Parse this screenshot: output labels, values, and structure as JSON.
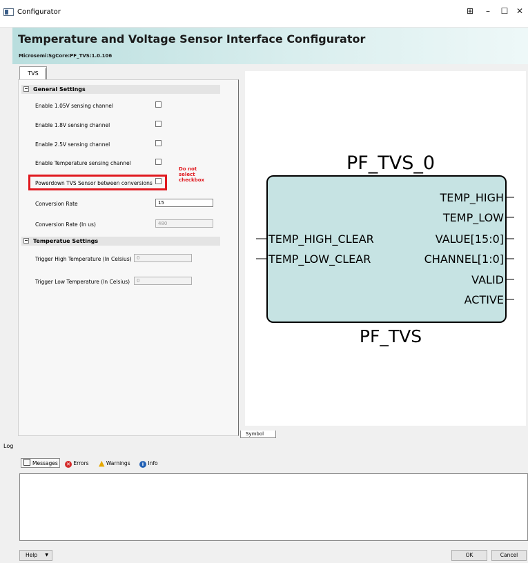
{
  "window": {
    "title": "Configurator",
    "controls": [
      "⊞",
      "–",
      "☐",
      "✕"
    ]
  },
  "header": {
    "title": "Temperature and Voltage Sensor Interface Configurator",
    "subtitle": "Microsemi:SgCore:PF_TVS:1.0.106"
  },
  "tabs": [
    "TVS"
  ],
  "general_settings": {
    "label": "General Settings",
    "options": [
      {
        "label": "Enable 1.05V sensing channel",
        "checked": false
      },
      {
        "label": "Enable 1.8V sensing channel",
        "checked": false
      },
      {
        "label": "Enable 2.5V sensing channel",
        "checked": false
      },
      {
        "label": "Enable Temperature  sensing channel",
        "checked": false
      },
      {
        "label": "Powerdown TVS Sensor between conversions",
        "checked": false
      }
    ],
    "conversion_rate_label": "Conversion Rate",
    "conversion_rate_value": "15",
    "conversion_rate_us_label": "Conversion Rate (In us)",
    "conversion_rate_us_value": "480"
  },
  "annotation": {
    "note": "Do not select checkbox",
    "color": "#e0191f"
  },
  "temperature_settings": {
    "label": "Temperatue Settings",
    "trigger_high_label": "Trigger High Temperature (In Celsius)",
    "trigger_high_value": "0",
    "trigger_low_label": "Trigger Low Temperature (In Celsius)",
    "trigger_low_value": "0"
  },
  "symbol": {
    "instance_name": "PF_TVS_0",
    "component_name": "PF_TVS",
    "inputs": [
      "TEMP_HIGH_CLEAR",
      "TEMP_LOW_CLEAR"
    ],
    "outputs": [
      "TEMP_HIGH",
      "TEMP_LOW",
      "VALUE[15:0]",
      "CHANNEL[1:0]",
      "VALID",
      "ACTIVE"
    ],
    "tab_label": "Symbol",
    "fill_color": "#c6e3e3"
  },
  "log": {
    "label": "Log",
    "tabs": [
      {
        "label": "Messages",
        "icon": "messages-icon"
      },
      {
        "label": "Errors",
        "icon": "error-icon"
      },
      {
        "label": "Warnings",
        "icon": "warning-icon"
      },
      {
        "label": "Info",
        "icon": "info-icon"
      }
    ]
  },
  "footer": {
    "help_label": "Help",
    "ok_label": "OK",
    "cancel_label": "Cancel"
  }
}
